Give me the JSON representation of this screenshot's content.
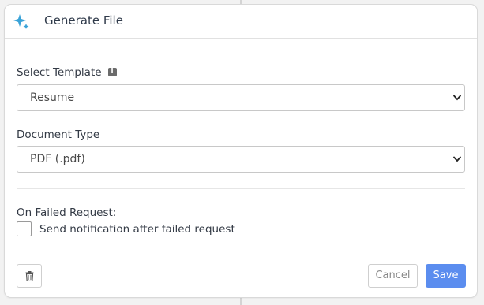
{
  "dialog": {
    "title": "Generate File",
    "header_icon": "sparkle-icon",
    "accent_color": "#3aa3d8"
  },
  "template_field": {
    "label": "Select Template",
    "info_icon": "info-icon",
    "selected_value": "Resume"
  },
  "document_type_field": {
    "label": "Document Type",
    "selected_value": "PDF (.pdf)"
  },
  "failed_request": {
    "label": "On Failed Request:",
    "checkbox_label": "Send notification after failed request",
    "checked": false
  },
  "footer": {
    "delete_icon": "trash-icon",
    "cancel_label": "Cancel",
    "save_label": "Save",
    "save_color": "#5b8def"
  }
}
